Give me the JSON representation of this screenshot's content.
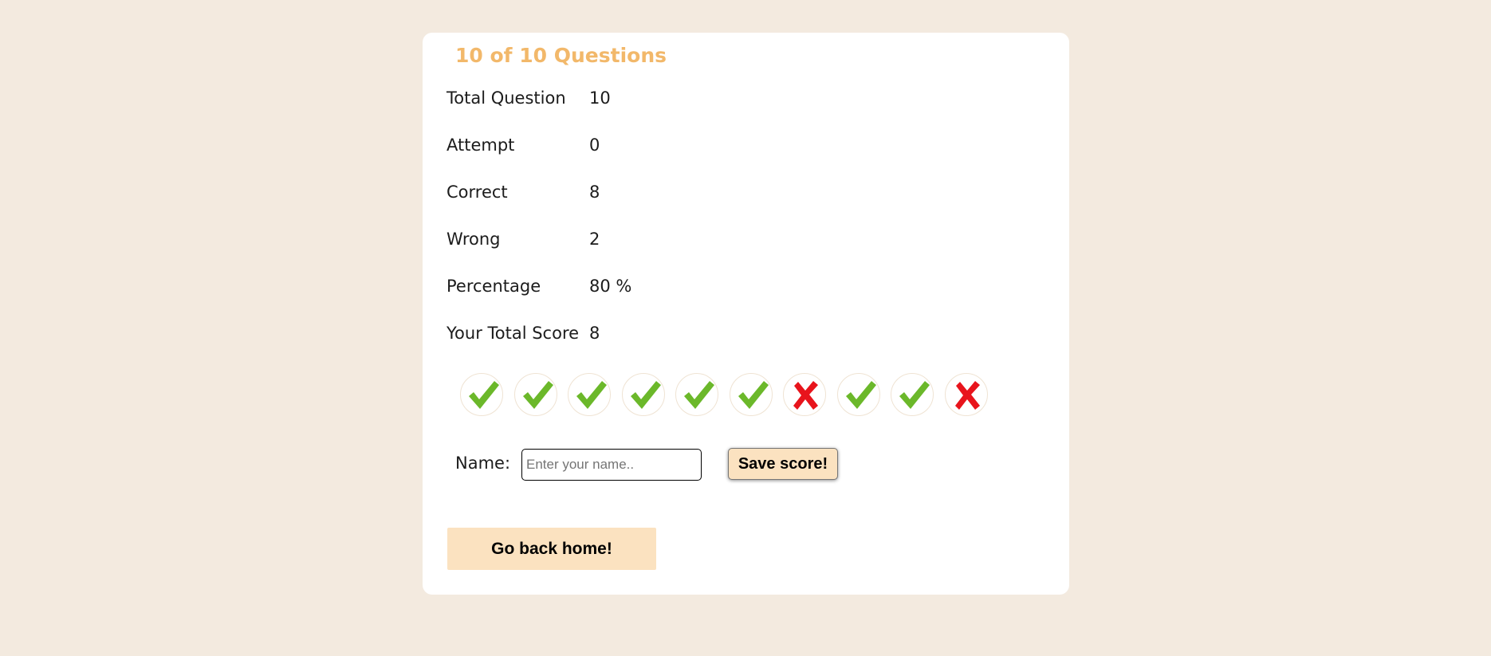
{
  "quiz": {
    "title": "10 of 10 Questions"
  },
  "stats": [
    {
      "label": "Total Question",
      "value": "10"
    },
    {
      "label": "Attempt",
      "value": "0"
    },
    {
      "label": "Correct",
      "value": "8"
    },
    {
      "label": "Wrong",
      "value": "2"
    },
    {
      "label": "Percentage",
      "value": "80 %"
    },
    {
      "label": "Your Total Score",
      "value": "8"
    }
  ],
  "results": [
    {
      "outcome": "correct",
      "icon": "check-icon"
    },
    {
      "outcome": "correct",
      "icon": "check-icon"
    },
    {
      "outcome": "correct",
      "icon": "check-icon"
    },
    {
      "outcome": "correct",
      "icon": "check-icon"
    },
    {
      "outcome": "correct",
      "icon": "check-icon"
    },
    {
      "outcome": "correct",
      "icon": "check-icon"
    },
    {
      "outcome": "wrong",
      "icon": "cross-icon"
    },
    {
      "outcome": "correct",
      "icon": "check-icon"
    },
    {
      "outcome": "correct",
      "icon": "check-icon"
    },
    {
      "outcome": "wrong",
      "icon": "cross-icon"
    }
  ],
  "save_form": {
    "name_label": "Name:",
    "name_value": "",
    "name_placeholder": "Enter your name..",
    "save_label": "Save score!"
  },
  "home_button_label": "Go back home!",
  "colors": {
    "page_background": "#f3eadf",
    "card_background": "#ffffff",
    "title": "#f2b86a",
    "button_background": "#fbe2c0",
    "correct": "#6bb82a",
    "wrong": "#e8141c"
  }
}
